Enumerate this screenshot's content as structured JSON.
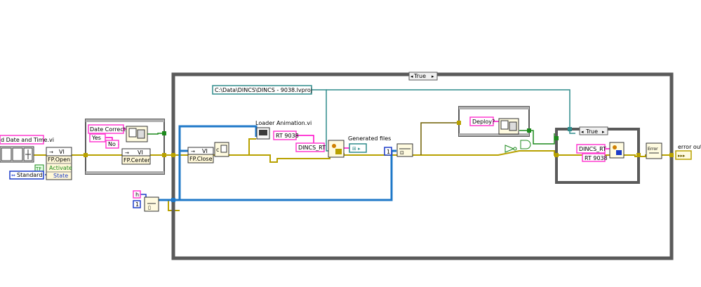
{
  "labels": {
    "date_time_vi": "d Date and Time.vi",
    "fp_open": "FP.Open",
    "activate": "Activate",
    "state": "State",
    "standard": "Standard",
    "tf_const": "TF",
    "date_correct": "Date Correct?",
    "yes": "Yes",
    "no": "No",
    "fp_center": "FP.Center",
    "vi": "VI",
    "case_selector_outer": "True",
    "path_const": "C:\\Data\\DINCS\\DINCS - 9038.lvproj",
    "fp_close": "FP.Close",
    "loader_animation": "Loader Animation.vi",
    "rt_9038": "RT 9038",
    "dincs_rt": "DINCS_RT",
    "generated_files": "Generated files",
    "index_const": "1",
    "h_const": "h",
    "one_const": "1",
    "deploy": "Deploy?",
    "case_selector_inner": "True",
    "error_out": "error out"
  },
  "colors": {
    "wire_error": "#b8a100",
    "wire_error_dark": "#6e5f00",
    "wire_refnum": "#1f78c8",
    "wire_path": "#2e8b8b",
    "wire_string": "#ff00c8",
    "wire_bool": "#1c8a1c",
    "structure_border": "#5a5a5a",
    "text_const_border": "#ff3cd0",
    "enum_border": "#1c3cc8"
  }
}
